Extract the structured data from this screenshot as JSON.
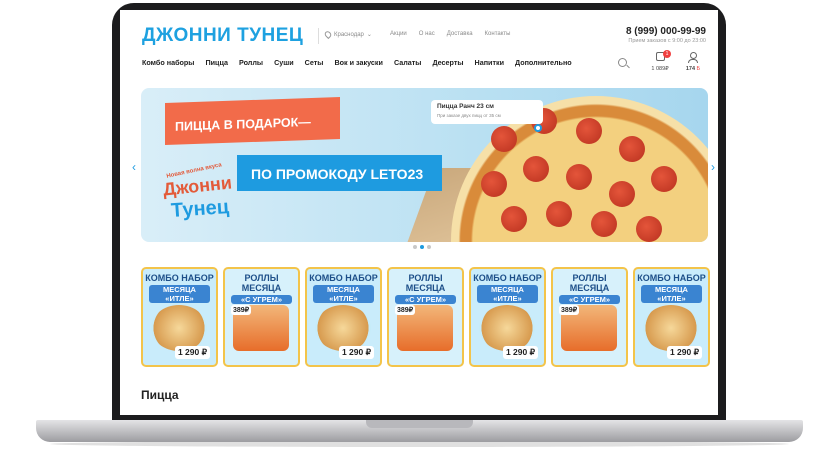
{
  "header": {
    "logo": "ДЖОННИ ТУНЕЦ",
    "city": "Краснодар",
    "links": [
      "Акции",
      "О нас",
      "Доставка",
      "Контакты"
    ],
    "phone": "8 (999) 000-99-99",
    "hours": "Прием заказов с 9:00 до 23:00"
  },
  "nav": [
    "Комбо наборы",
    "Пицца",
    "Роллы",
    "Суши",
    "Сеты",
    "Вок и закуски",
    "Салаты",
    "Десерты",
    "Напитки",
    "Дополнительно"
  ],
  "cart": {
    "badge": "1",
    "sum": "1 089₽"
  },
  "user": {
    "points": "174",
    "points_unit": "Б"
  },
  "banner": {
    "line1": "ПИЦЦА В ПОДАРОК—",
    "line2": "ПО ПРОМОКОДУ LETO23",
    "sub": "Новая волна вкуса",
    "brand1": "Джонни",
    "brand2": "Тунец",
    "tag_title": "Пицца Ранч 23 см",
    "tag_note": "При заказе двух пицц от 35 см"
  },
  "cards": [
    {
      "title": "КОМБО НАБОР",
      "subtitle": "МЕСЯЦА «ИТЛЕ»",
      "price": "1 290 ₽",
      "kind": "combo"
    },
    {
      "title": "РОЛЛЫ МЕСЯЦА",
      "subtitle": "«С УГРЕМ»",
      "price": "389₽",
      "kind": "roll"
    },
    {
      "title": "КОМБО НАБОР",
      "subtitle": "МЕСЯЦА «ИТЛЕ»",
      "price": "1 290 ₽",
      "kind": "combo"
    },
    {
      "title": "РОЛЛЫ МЕСЯЦА",
      "subtitle": "«С УГРЕМ»",
      "price": "389₽",
      "kind": "roll"
    },
    {
      "title": "КОМБО НАБОР",
      "subtitle": "МЕСЯЦА «ИТЛЕ»",
      "price": "1 290 ₽",
      "kind": "combo"
    },
    {
      "title": "РОЛЛЫ МЕСЯЦА",
      "subtitle": "«С УГРЕМ»",
      "price": "389₽",
      "kind": "roll"
    },
    {
      "title": "КОМБО НАБОР",
      "subtitle": "МЕСЯЦА «ИТЛЕ»",
      "price": "1 290 ₽",
      "kind": "combo"
    }
  ],
  "section_title": "Пицца"
}
